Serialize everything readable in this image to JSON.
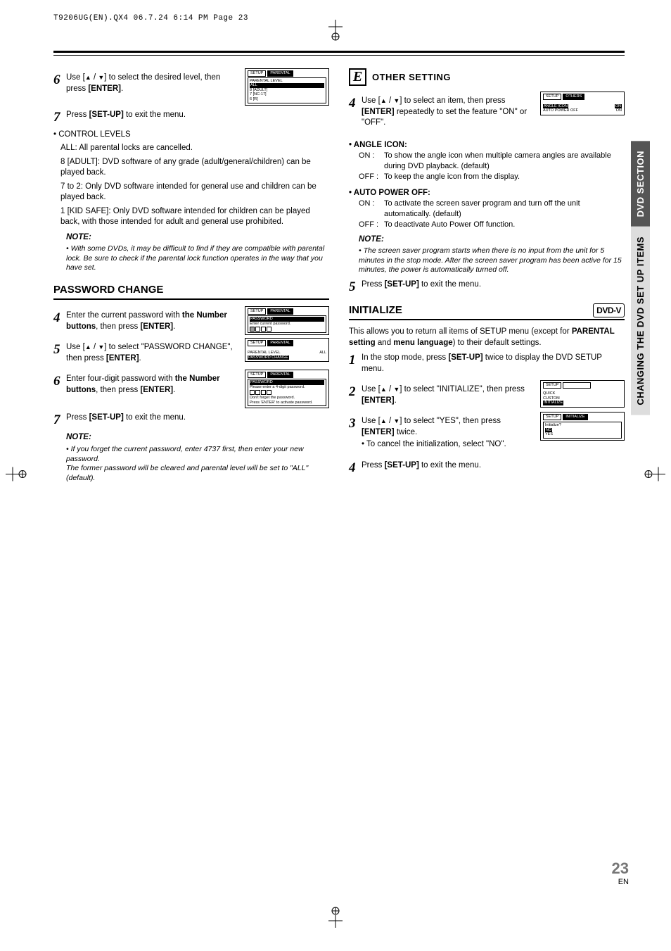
{
  "print_header": "T9206UG(EN).QX4  06.7.24  6:14 PM  Page 23",
  "left": {
    "step6": {
      "text_a": "Use [",
      "text_b": " / ",
      "text_c": "] to select the desired level, then press ",
      "text_enter": "[ENTER]",
      "text_d": "."
    },
    "osd1": {
      "tab_setup": "SETUP",
      "tab_parental": "PARENTAL",
      "inner_title": "PARENTAL LEVEL",
      "opt_all": "ALL",
      "opt_8": "8 [ADULT]",
      "opt_7": "7 [NC-17]",
      "opt_6": "6 [R]"
    },
    "step7": {
      "text_a": "Press ",
      "bold": "[SET-UP]",
      "text_b": " to exit the menu."
    },
    "control_levels_heading": "CONTROL LEVELS",
    "cl_all": "ALL: All parental locks are cancelled.",
    "cl_8": "8 [ADULT]: DVD software of any grade (adult/general/children) can be played back.",
    "cl_7to2": "7 to 2: Only DVD software intended for general use and children can be played back.",
    "cl_1": "1 [KID SAFE]: Only DVD software intended for children can be played back, with those intended for adult and general use prohibited.",
    "note1_title": "NOTE:",
    "note1_body": "• With some DVDs, it may be difficult to find if they are compatible with parental lock. Be sure to check if the parental lock function operates in the way that you have set.",
    "password_heading": "PASSWORD CHANGE",
    "step4": {
      "text_a": "Enter the current password with ",
      "bold": "the Number buttons",
      "text_b": ", then press ",
      "enter": "[ENTER]",
      "text_c": "."
    },
    "osd2": {
      "tab_setup": "SETUP",
      "tab_parental": "PARENTAL",
      "inner_title": "PASSWORD",
      "line": "Enter current password."
    },
    "step5": {
      "text_a": "Use [",
      "text_b": " / ",
      "text_c": "] to select \"PASSWORD CHANGE\", then press ",
      "enter": "[ENTER]",
      "text_d": "."
    },
    "osd3": {
      "tab_setup": "SETUP",
      "tab_parental": "PARENTAL",
      "line1": "PARENTAL LEVEL",
      "val1": "ALL",
      "line2": "PASSWORD CHANGE"
    },
    "step6b": {
      "text_a": "Enter four-digit password with ",
      "bold": "the Number buttons",
      "text_b": ", then press ",
      "enter": "[ENTER]",
      "text_c": "."
    },
    "osd4": {
      "tab_setup": "SETUP",
      "tab_parental": "PARENTAL",
      "inner_title": "PASSWORD",
      "line1": "Please enter a 4-digit password.",
      "line2": "Don't forget the password.",
      "line3": "Press 'ENTER' to activate password."
    },
    "step7b": {
      "text_a": "Press ",
      "bold": "[SET-UP]",
      "text_b": " to exit the menu."
    },
    "note2_title": "NOTE:",
    "note2_body1": "• If you forget the current password, enter 4737 first, then enter your new password.",
    "note2_body2": "The former password will be cleared and parental level will be set to \"ALL\" (default)."
  },
  "right": {
    "letter": "E",
    "letter_title": "OTHER SETTING",
    "step4": {
      "text_a": "Use [",
      "text_b": " / ",
      "text_c": "] to select an item, then press ",
      "bold": "[ENTER]",
      "text_d": " repeatedly to set the feature \"ON\" or \"OFF\"."
    },
    "osd1": {
      "tab_setup": "SETUP",
      "tab_others": "OTHERS",
      "row1a": "ANGLE ICON",
      "row1b": "ON",
      "row2a": "AUTO POWER OFF",
      "row2b": "ON"
    },
    "angle_heading": "• ANGLE ICON:",
    "angle_on_term": "ON  :",
    "angle_on": "To show the angle icon when multiple camera angles are available during DVD playback. (default)",
    "angle_off_term": "OFF :",
    "angle_off": "To keep the angle icon from the display.",
    "apo_heading": "• AUTO POWER OFF:",
    "apo_on_term": "ON  :",
    "apo_on": "To activate the screen saver program and turn off the unit automatically. (default)",
    "apo_off_term": "OFF :",
    "apo_off": "To deactivate Auto Power Off function.",
    "note_title": "NOTE:",
    "note_body": "• The screen saver program starts when there is no input from the unit for 5 minutes in the stop mode. After the screen saver program has been active for 15 minutes, the power is automatically turned off.",
    "step5": {
      "text_a": "Press ",
      "bold": "[SET-UP]",
      "text_b": " to exit the menu."
    },
    "initialize_heading": "INITIALIZE",
    "dvd_logo": "DVD-V",
    "init_intro_a": "This allows you to return all items of SETUP menu (except for ",
    "init_intro_bold1": "PARENTAL setting",
    "init_intro_and": " and ",
    "init_intro_bold2": "menu language",
    "init_intro_b": ") to their default settings.",
    "i_step1": {
      "text_a": "In the stop mode, press ",
      "bold": "[SET-UP]",
      "text_b": " twice to display the DVD SETUP menu."
    },
    "i_step2": {
      "text_a": "Use [",
      "text_b": " / ",
      "text_c": "] to select \"INITIALIZE\", then press ",
      "enter": "[ENTER]",
      "text_d": "."
    },
    "osd2": {
      "tab_setup": "SETUP",
      "tab_blank": " ",
      "l1": "QUICK",
      "l2": "CUSTOM",
      "l3": "INITIALIZE"
    },
    "i_step3": {
      "text_a": "Use [",
      "text_b": " / ",
      "text_c": "] to select \"YES\", then press ",
      "enter": "[ENTER]",
      "text_d": " twice.",
      "cancel": "• To cancel the initialization, select \"NO\"."
    },
    "osd3": {
      "tab_setup": "SETUP",
      "tab_init": "INITIALIZE",
      "q": "Initialize?",
      "no": "NO",
      "yes": "YES"
    },
    "i_step4": {
      "text_a": "Press ",
      "bold": "[SET-UP]",
      "text_b": " to exit the menu."
    }
  },
  "side_tab_top": "DVD SECTION",
  "side_tab_bottom": "CHANGING THE DVD SET UP ITEMS",
  "page_number": "23",
  "page_en": "EN"
}
